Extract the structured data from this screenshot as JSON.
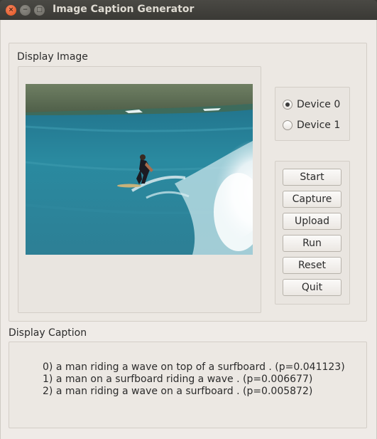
{
  "window": {
    "title": "Image Caption Generator",
    "close_glyph": "×",
    "minimize_glyph": "−",
    "maximize_glyph": "□"
  },
  "display_image": {
    "label": "Display Image",
    "image": "surfer riding a breaking wave"
  },
  "devices": {
    "options": [
      {
        "label": "Device 0",
        "checked": true
      },
      {
        "label": "Device 1",
        "checked": false
      }
    ]
  },
  "buttons": {
    "start": "Start",
    "capture": "Capture",
    "upload": "Upload",
    "run": "Run",
    "reset": "Reset",
    "quit": "Quit"
  },
  "display_caption": {
    "label": "Display Caption",
    "lines": [
      "0) a man riding a wave on top of a surfboard . (p=0.041123)",
      "1) a man on a surfboard riding a wave . (p=0.006677)",
      "2) a man riding a wave on a surfboard . (p=0.005872)"
    ]
  },
  "colors": {
    "close_button": "#e0531f",
    "window_bg": "#efebe7",
    "titlebar": "#3c3b37"
  }
}
